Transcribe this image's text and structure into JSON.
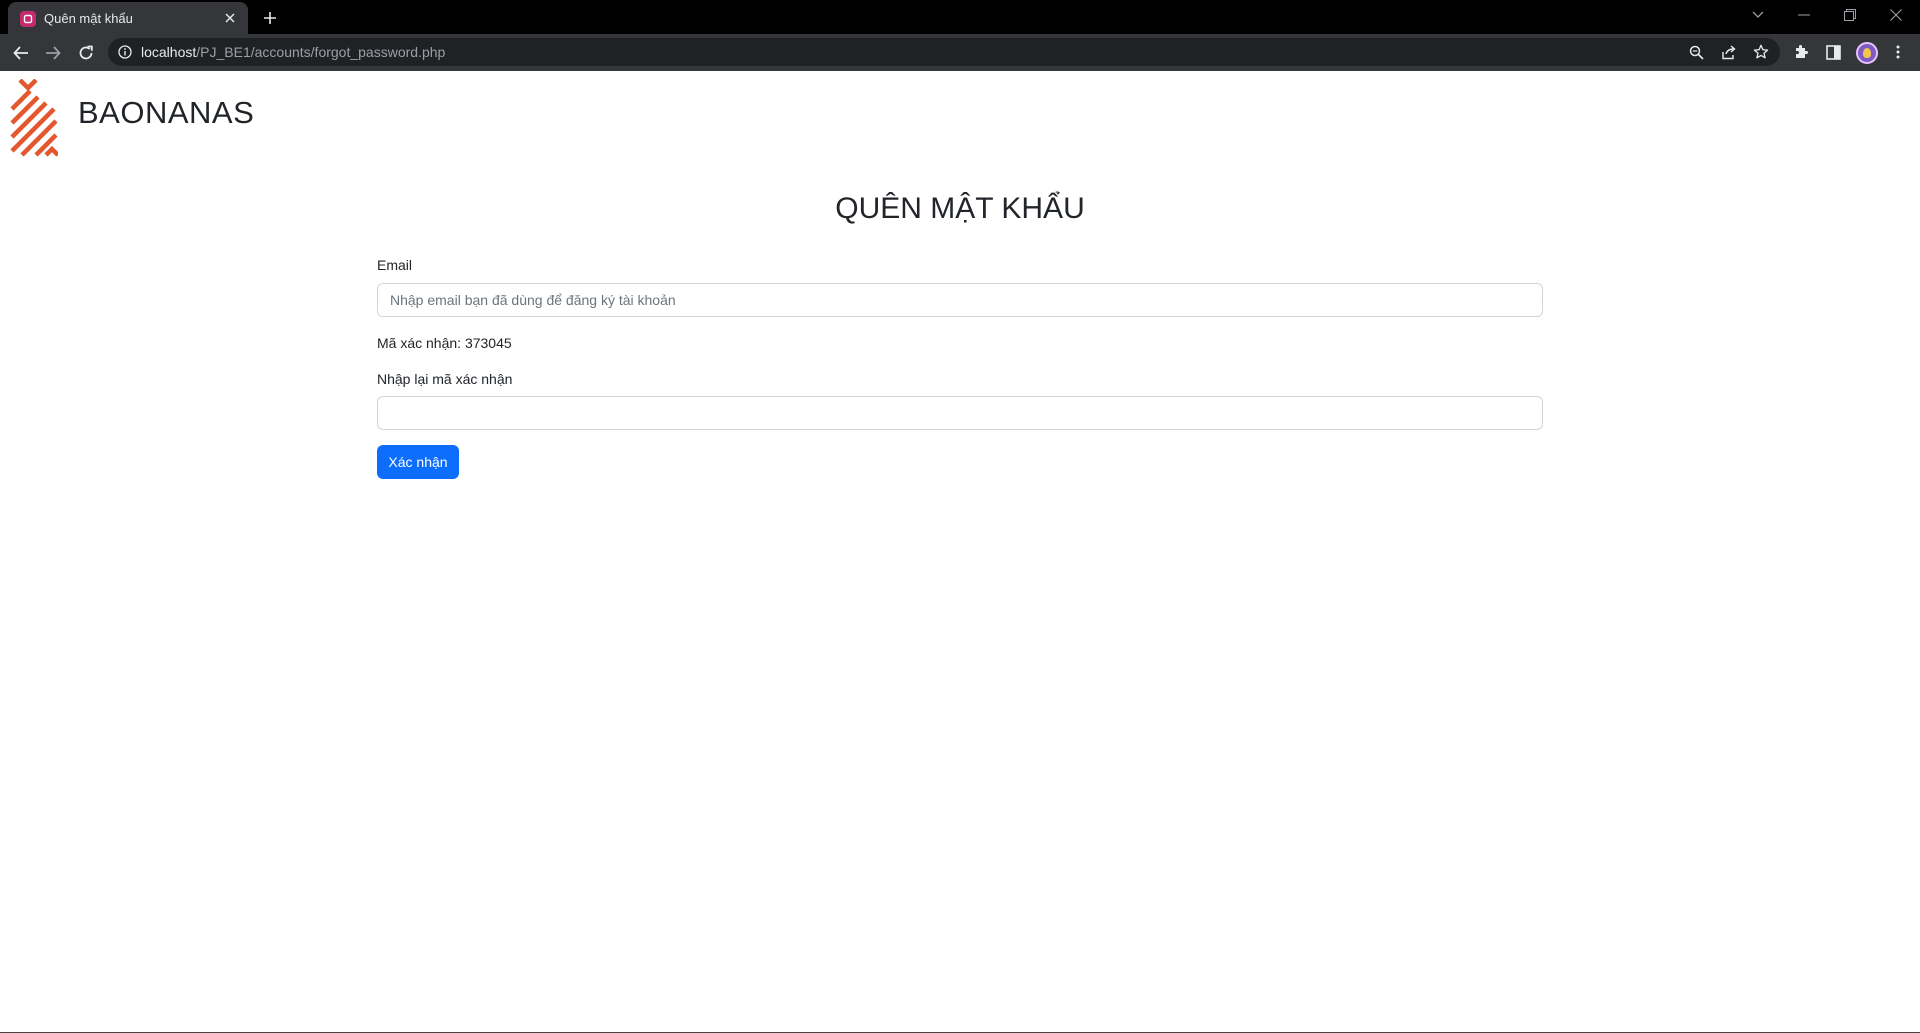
{
  "browser": {
    "tab_title": "Quên mật khẩu",
    "url_host": "localhost",
    "url_path": "/PJ_BE1/accounts/forgot_password.php"
  },
  "page": {
    "brand": "BAONANAS",
    "heading": "QUÊN MẬT KHẨU",
    "email_label": "Email",
    "email_placeholder": "Nhập email bạn đã dùng để đăng ký tài khoản",
    "email_value": "",
    "code_text": "Mã xác nhận: 373045",
    "code_confirm_label": "Nhập lại mã xác nhận",
    "code_confirm_value": "",
    "submit_label": "Xác nhận"
  },
  "colors": {
    "brand_accent": "#e4572e",
    "primary_button": "#0d6efd",
    "chrome_toolbar": "#35363a"
  },
  "icons": [
    "favicon-icon",
    "close-icon",
    "plus-icon",
    "chevron-down-icon",
    "minimize-icon",
    "restore-icon",
    "window-close-icon",
    "back-arrow-icon",
    "forward-arrow-icon",
    "reload-icon",
    "info-icon",
    "zoom-icon",
    "share-icon",
    "star-icon",
    "extensions-icon",
    "side-panel-icon",
    "avatar",
    "kebab-menu-icon",
    "logo-icon"
  ]
}
